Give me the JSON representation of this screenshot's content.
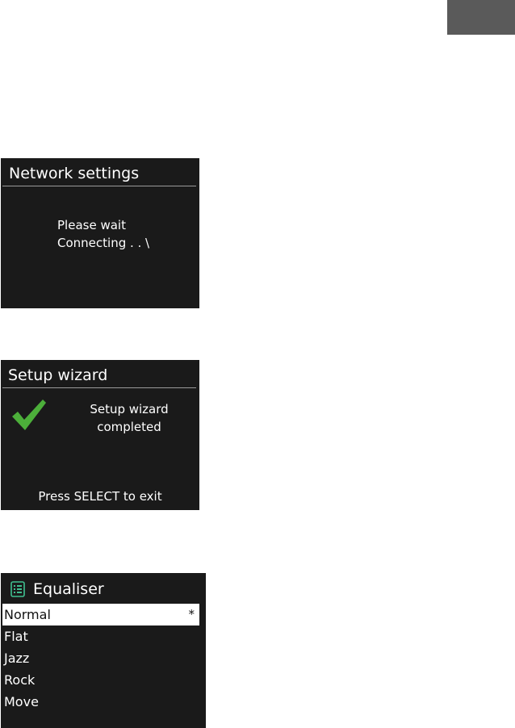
{
  "screens": {
    "network": {
      "title": "Network settings",
      "line1": "Please wait",
      "line2": "Connecting . . \\"
    },
    "wizard": {
      "title": "Setup wizard",
      "line1": "Setup wizard",
      "line2": "completed",
      "hint": "Press SELECT to exit",
      "icon": "check-icon"
    },
    "equaliser": {
      "title": "Equaliser",
      "icon": "list-icon",
      "items": [
        {
          "label": "Normal",
          "marker": "*",
          "selected": true
        },
        {
          "label": "Flat"
        },
        {
          "label": "Jazz"
        },
        {
          "label": "Rock"
        },
        {
          "label": "Move"
        }
      ]
    }
  },
  "colors": {
    "screen_bg": "#1a1a1a",
    "text": "#ffffff",
    "check": "#4caf3a",
    "page_tab": "#5a5a5a",
    "eq_icon": "#3fbf8f"
  }
}
